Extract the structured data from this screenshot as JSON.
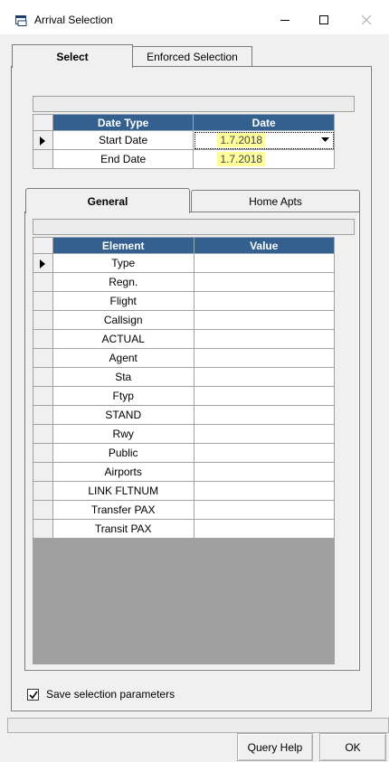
{
  "window": {
    "title": "Arrival Selection",
    "icons": [
      "window-icon",
      "minimize-icon",
      "maximize-icon",
      "close-icon"
    ]
  },
  "outer_tabs": [
    {
      "label": "Select",
      "active": true
    },
    {
      "label": "Enforced Selection",
      "active": false
    }
  ],
  "date_grid": {
    "headers": [
      "Date Type",
      "Date"
    ],
    "rows": [
      {
        "type": "Start Date",
        "date": "1.7.2018",
        "current": true
      },
      {
        "type": "End Date",
        "date": "1.7.2018",
        "current": false
      }
    ]
  },
  "inner_tabs": [
    {
      "label": "General",
      "active": true
    },
    {
      "label": "Home Apts",
      "active": false
    }
  ],
  "element_grid": {
    "headers": [
      "Element",
      "Value"
    ],
    "rows": [
      "Type",
      "Regn.",
      "Flight",
      "Callsign",
      "ACTUAL",
      "Agent",
      "Sta",
      "Ftyp",
      "STAND",
      "Rwy",
      "Public",
      "Airports",
      "LINK FLTNUM",
      "Transfer PAX",
      "Transit PAX"
    ],
    "values": [
      "",
      "",
      "",
      "",
      "",
      "",
      "",
      "",
      "",
      "",
      "",
      "",
      "",
      "",
      ""
    ]
  },
  "save_params": {
    "label": "Save selection parameters",
    "checked": true
  },
  "buttons": {
    "query_help": "Query Help",
    "ok": "OK"
  },
  "colors": {
    "grid_header": "#33608f",
    "date_highlight": "#fefe9a"
  }
}
